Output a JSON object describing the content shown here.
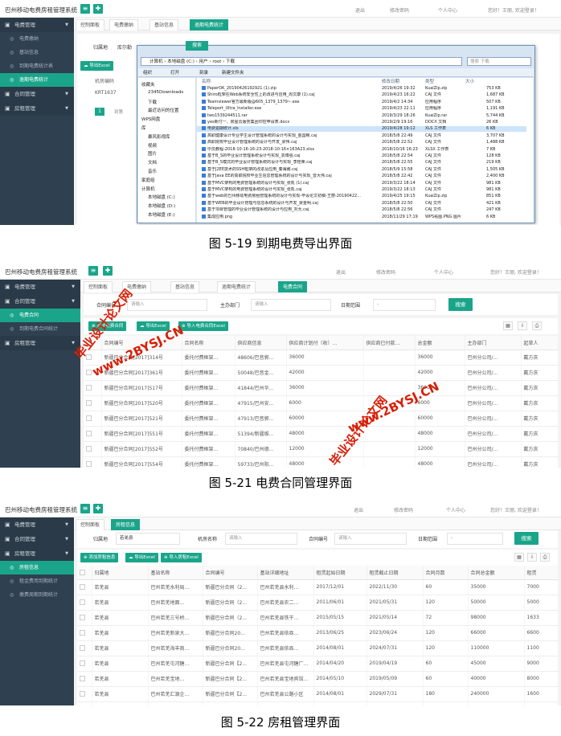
{
  "app_title": "巴州移动电费房租管理系统",
  "top_links": {
    "logout": "退出",
    "change_password": "修改密码",
    "personal_center": "个人中心",
    "greeting": "您好！王丽, 欢迎登录！"
  },
  "fig19": {
    "sidebar": [
      {
        "type": "group",
        "label": "电费管理"
      },
      {
        "type": "item",
        "label": "电费缴纳"
      },
      {
        "type": "item",
        "label": "基站信息"
      },
      {
        "type": "item",
        "label": "到期电费统计表"
      },
      {
        "type": "item",
        "label": "逾期电费统计",
        "active": true
      },
      {
        "type": "group",
        "label": "合同管理"
      },
      {
        "type": "group",
        "label": "房租管理"
      }
    ],
    "tabs": [
      "控制面板",
      "电费缴纳",
      "基站信息",
      "逾期电费统计"
    ],
    "subtabs": [
      "归属地",
      "库尔勒"
    ],
    "export_label": "导出Excel",
    "col_header": "机房编码",
    "row_value": "KRT1637",
    "pager": {
      "page": "1",
      "goto": "到第"
    },
    "dialog": {
      "search_button": "搜索",
      "address": "计算机 › 本地磁盘 (C:) › 用户 › root › 下载",
      "search_placeholder": "搜索 下载",
      "toolbar": [
        "组织",
        "打开",
        "刻录",
        "新建文件夹"
      ],
      "tree": [
        "收藏夹",
        "2345Downloads",
        "下载",
        "最近访问的位置",
        "WPS网盘",
        "库",
        "暴风影视库",
        "视频",
        "图片",
        "文档",
        "音乐",
        "家庭组",
        "计算机",
        "本地磁盘 (C:)",
        "本地磁盘 (D:)",
        "本地磁盘 (E:)"
      ],
      "headers": [
        "名称",
        "修改日期",
        "类型",
        "大小"
      ],
      "files": [
        [
          "PaperOK_20190426192921 (1).zip",
          "2019/4/26 19:32",
          "KuaiZip.zip",
          "753 KB"
        ],
        [
          "Shiro框架在Web系统安全性上的改进与应用_周文康 (1).caj",
          "2019/4/23 16:22",
          "CAJ 文件",
          "1,687 KB"
        ],
        [
          "Teamviewer官方最新版@605_1379_1379~.exe",
          "2019/4/2 14:34",
          "应用程序",
          "507 KB"
        ],
        [
          "Teleport_Ultra_Installer.exe",
          "2019/4/23 22:11",
          "应用程序",
          "1,191 KB"
        ],
        [
          "two1539244511.rar",
          "2019/3/29 18:26",
          "KuaiZip.rar",
          "5,744 KB"
        ],
        [
          "yes新付一、房屋云服务集团印控申请表.docx",
          "2019/2/9 19:16",
          "DOCX 文档",
          "26 KB"
        ],
        [
          "电费逾期统计.xls",
          "2019/4/28 19:12",
          "XLS 工作表",
          "6 KB"
        ],
        [
          "高职健康设计专业学生设计管理系统的设计与实现_金国稷.caj",
          "2018/5/8 22:49",
          "CAJ 文件",
          "3,707 KB"
        ],
        [
          "高职院校毕业设计管理系统的设计与开发_梁伟.caj",
          "2018/5/8 22:52",
          "CAJ 文件",
          "1,488 KB"
        ],
        [
          "中员教程-2018-10-16-16-23-2018-10-16×163A23.xlsx",
          "2018/10/16 16:23",
          "XLSX 工作表",
          "7 KB"
        ],
        [
          "基于B_S的毕业设计管理系统设计与实现_袁博强.caj",
          "2018/5/8 22:54",
          "CAJ 文件",
          "128 KB"
        ],
        [
          "基于B_S模式的毕业设计管理系统的设计与实现_李桂荣.caj",
          "2018/5/8 22:55",
          "CAJ 文件",
          "219 KB"
        ],
        [
          "基于J2EE技术的SSH框架的改进及应用_秦海崴.caj",
          "2018/5/9 15:58",
          "CAJ 文件",
          "1,505 KB"
        ],
        [
          "基于Java EE的高职院校毕业生信息管理系统的设计与实现_曾大伟.caj",
          "2018/5/8 22:42",
          "CAJ 文件",
          "2,400 KB"
        ],
        [
          "基于MVC架构的电费管理系统的设计与实现_张凯 (1).caj",
          "2019/3/22 18:14",
          "CAJ 文件",
          "981 KB"
        ],
        [
          "基于MVC架构的电费管理系统的设计与实现_张凯.caj",
          "2019/3/22 18:13",
          "CAJ 文件",
          "981 KB"
        ],
        [
          "基于web的巴州移动电费房租管理系统的设计与实现-毕设论文初稿-王丽-20190422...",
          "2019/4/25 19:15",
          "KuaiZip.zip",
          "851 KB"
        ],
        [
          "基于WEB的毕业设计管理与信息系统的设计与开发_梁金明.caj",
          "2018/5/8 22:50",
          "CAJ 文件",
          "421 KB"
        ],
        [
          "基于项目管理的毕业设计管理系统的设计与应用_刘允.caj",
          "2018/5/8 22:56",
          "CAJ 文件",
          "247 KB"
        ],
        [
          "集成应用.png",
          "2018/11/29 17:19",
          "WPS看图.PNG 图片",
          "6 KB"
        ]
      ]
    }
  },
  "caption19": "图 5-19  到期电费导出界面",
  "fig21": {
    "sidebar": [
      {
        "type": "group",
        "label": "电费管理"
      },
      {
        "type": "group",
        "label": "合同管理"
      },
      {
        "type": "item",
        "label": "电费合同",
        "active": true
      },
      {
        "type": "item",
        "label": "到期电费合同统计"
      },
      {
        "type": "group",
        "label": "房租管理"
      }
    ],
    "tabs": [
      "控制面板",
      "电费缴纳",
      "基站信息",
      "逾期电费统计",
      "电费合同"
    ],
    "search": {
      "contract_no_label": "合同编号",
      "contract_no_placeholder": "请输入",
      "dept_label": "主办部门",
      "dept_placeholder": "请输入",
      "date_label": "日期范围",
      "date_value": "-",
      "button": "搜索"
    },
    "toolbar": [
      "添加电费合同",
      "导出Excel",
      "导入电费合同Excel"
    ],
    "columns": [
      "合同编号",
      "合同名称",
      "供应商信息",
      "供应商计划付（收）...",
      "供应商已付款...",
      "总金额",
      "主办部门",
      "起草人"
    ],
    "rows": [
      [
        "新疆巴分合同[2017]314号",
        "委托付费框架...",
        "48606/巴音郭...",
        "36000",
        "",
        "36000",
        "巴州分公司/...",
        "戴方庆"
      ],
      [
        "新疆巴分合同[2017]361号",
        "委托付费框架...",
        "50048/巴音金...",
        "42000",
        "",
        "42000",
        "巴州分公司/...",
        "戴方庆"
      ],
      [
        "新疆巴分合同[2017]517号",
        "委托付费框架...",
        "41844/巴州华...",
        "36000",
        "",
        "36000",
        "巴州分公司/...",
        "戴方庆"
      ],
      [
        "新疆巴分合同[2017]520号",
        "委托付费框架...",
        "47915/巴州安...",
        "6000",
        "",
        "6000",
        "巴州分公司/...",
        "戴方庆"
      ],
      [
        "新疆巴分合同[2017]521号",
        "委托付费框架...",
        "47913/巴音郭...",
        "60000",
        "",
        "60000",
        "巴州分公司/...",
        "戴方庆"
      ],
      [
        "新疆巴分合同[2017]551号",
        "委托付费框架...",
        "51394/新疆维...",
        "48000",
        "",
        "48000",
        "巴州分公司/...",
        "戴方庆"
      ],
      [
        "新疆巴分合同[2017]552号",
        "委托付费框架...",
        "70840/巴州德...",
        "12000",
        "",
        "12000",
        "巴州分公司/...",
        "戴方庆"
      ],
      [
        "新疆巴分合同[2017]554号",
        "委托付费框架...",
        "59733/巴州阳...",
        "48000",
        "",
        "48000",
        "巴州分公司/...",
        "戴方庆"
      ]
    ],
    "watermark": "毕业设计论文网 www.2BYSJ.CN"
  },
  "caption21": "图 5-21  电费合同管理界面",
  "fig22": {
    "sidebar": [
      {
        "type": "group",
        "label": "电费管理"
      },
      {
        "type": "group",
        "label": "合同管理"
      },
      {
        "type": "group",
        "label": "房租管理"
      },
      {
        "type": "item",
        "label": "房租信息",
        "active": true
      },
      {
        "type": "item",
        "label": "租金费用到期统计"
      },
      {
        "type": "item",
        "label": "缴费周期到期统计"
      }
    ],
    "tabs": [
      "控制面板",
      "房租信息"
    ],
    "search": {
      "region_label": "归属地",
      "region_value": "若羌县",
      "room_label": "机房名称",
      "room_placeholder": "请输入",
      "contract_label": "合同编号",
      "contract_placeholder": "请输入",
      "date_label": "日期范围",
      "date_value": "-",
      "button": "搜索"
    },
    "toolbar": [
      "添加房租信息",
      "导出Excel",
      "导入房租Excel"
    ],
    "columns": [
      "归属地",
      "基站名称",
      "合同编号",
      "基站详细地址",
      "租赁起始日期",
      "租赁截止日期",
      "合同月数",
      "合同总金额",
      "租赁"
    ],
    "rows": [
      [
        "若羌县",
        "巴州若羌水利局...",
        "新疆巴分合同（2...",
        "巴州若羌县水利...",
        "2017/12/01",
        "2022/11/30",
        "60",
        "35000",
        "7000"
      ],
      [
        "若羌县",
        "巴州若羌地面...",
        "新疆巴分合同（2...",
        "巴州若羌县农二...",
        "2011/06/01",
        "2021/05/31",
        "120",
        "50000",
        "5000"
      ],
      [
        "若羌县",
        "巴州若羌三号桥...",
        "新疆巴分合同（2...",
        "巴州若羌县铁干...",
        "2015/05/15",
        "2021/05/14",
        "72",
        "98000",
        "1633"
      ],
      [
        "若羌县",
        "巴州若羌新泉大...",
        "新疆巴分合同20...",
        "巴州若羌县依吞...",
        "2013/06/25",
        "2023/06/24",
        "120",
        "66000",
        "6600"
      ],
      [
        "若羌县",
        "巴州若羌海丰商...",
        "新疆巴分合同20...",
        "巴州若羌县依吞...",
        "2014/08/01",
        "2024/07/31",
        "120",
        "110000",
        "1100"
      ],
      [
        "若羌县",
        "巴州若羌屯河糖...",
        "新疆巴分合同【2...",
        "巴州若羌县屯河糖厂...",
        "2014/04/20",
        "2019/04/19",
        "60",
        "45000",
        "9000"
      ],
      [
        "若羌县",
        "巴州若羌宝地...",
        "新疆巴分合同【2...",
        "巴州若羌县宝地宾馆...",
        "2014/05/10",
        "2019/05/09",
        "60",
        "40000",
        "8000"
      ],
      [
        "若羌县",
        "巴州若羌汇源企...",
        "新疆巴分合同【2...",
        "巴州若羌县公路小区",
        "2014/08/01",
        "2029/07/31",
        "180",
        "240000",
        "1600"
      ],
      [
        "若羌县",
        "巴州若羌大雁南...",
        "新疆巴分合同20...",
        "巴州若羌县恰萨西...",
        "2014/05/10",
        "2020/05/09",
        "72",
        "66000",
        "1100"
      ],
      [
        "若羌县",
        "巴州若羌县新华...",
        "新疆巴分合同20...",
        "巴州若羌县新华路1号...",
        "2012/07/10",
        "2022/07/09",
        "120",
        "110000",
        "1100"
      ]
    ]
  },
  "caption22": "图 5-22  房租管理界面"
}
